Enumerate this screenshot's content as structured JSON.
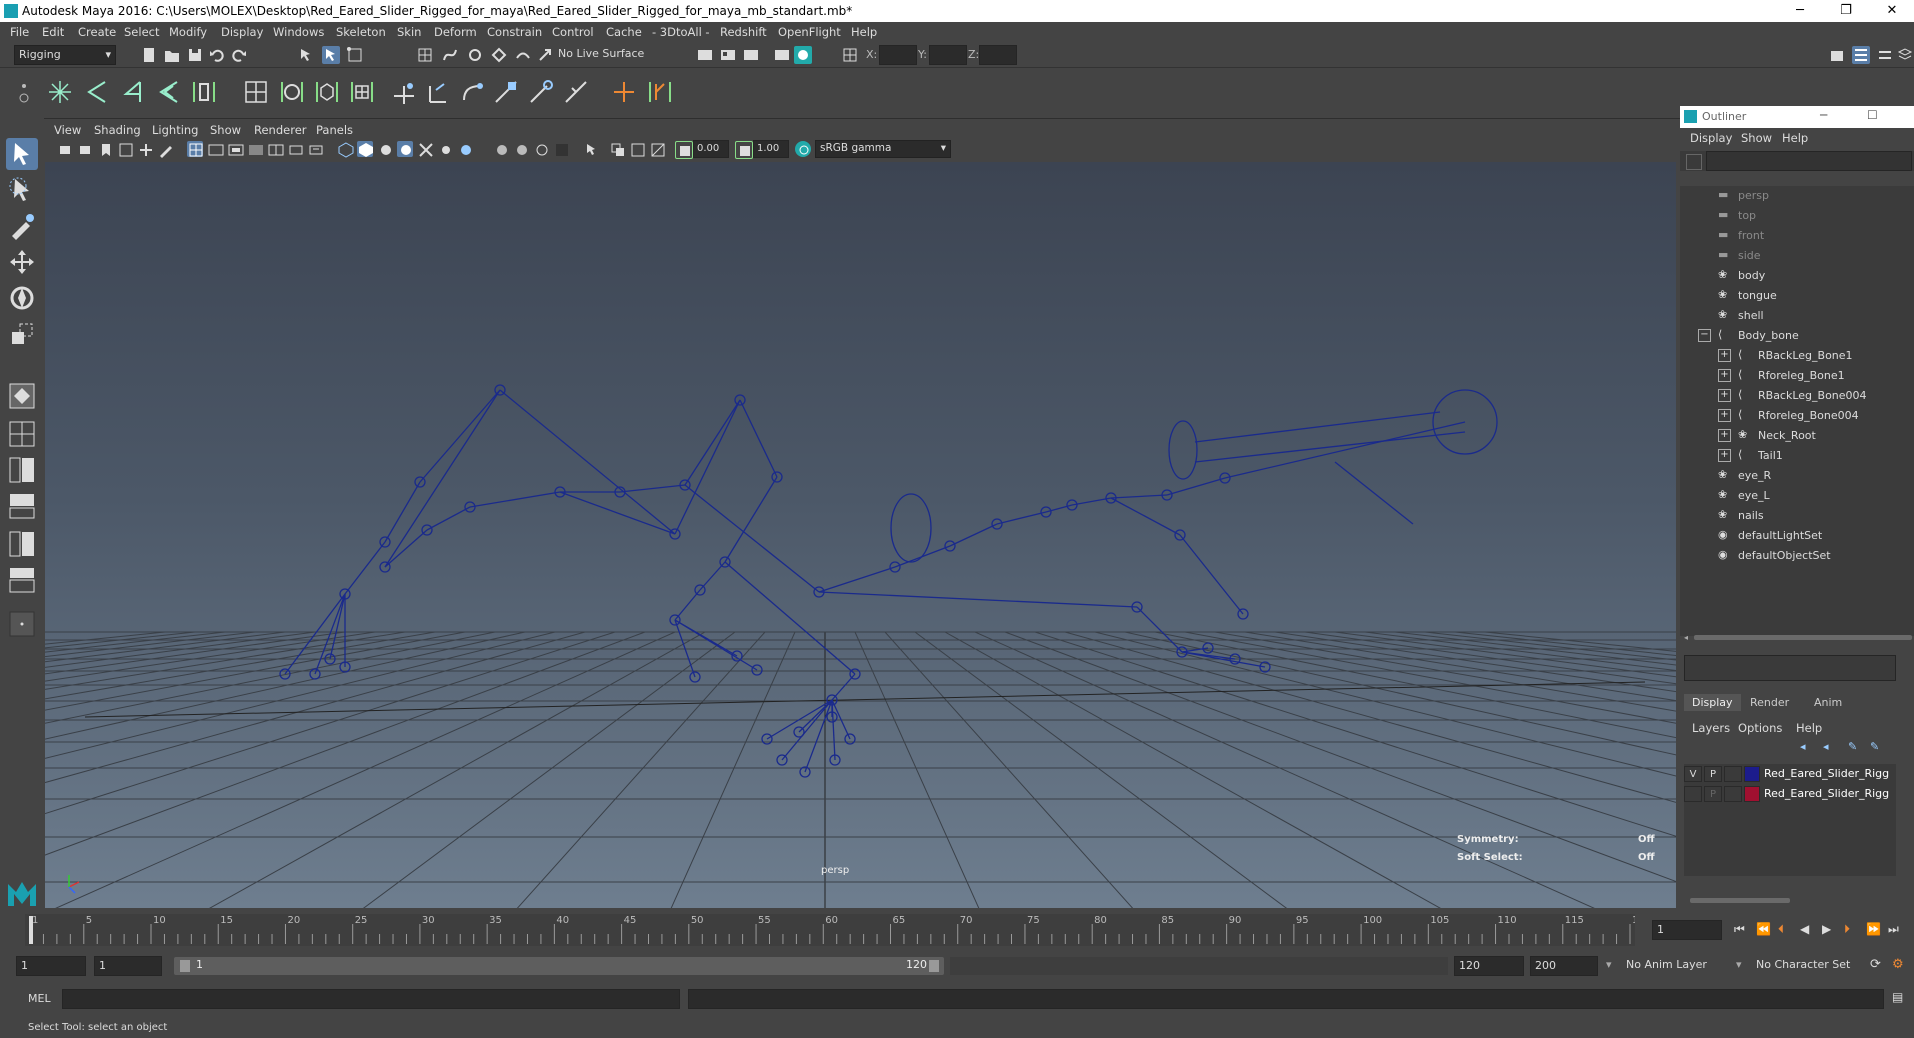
{
  "window": {
    "title": "Autodesk Maya 2016: C:\\Users\\MOLEX\\Desktop\\Red_Eared_Slider_Rigged_for_maya\\Red_Eared_Slider_Rigged_for_maya_mb_standart.mb*",
    "minimize": "─",
    "restore": "❐",
    "close": "✕"
  },
  "menubar": [
    "File",
    "Edit",
    "Create",
    "Select",
    "Modify",
    "Display",
    "Windows",
    "Skeleton",
    "Skin",
    "Deform",
    "Constrain",
    "Control",
    "Cache",
    "- 3DtoAll -",
    "Redshift",
    "OpenFlight",
    "Help"
  ],
  "statusline": {
    "menuset": "Rigging",
    "live_surface": "No Live Surface",
    "x_label": "X:",
    "y_label": "Y:",
    "z_label": "Z:"
  },
  "viewport": {
    "menus": [
      "View",
      "Shading",
      "Lighting",
      "Show",
      "Renderer",
      "Panels"
    ],
    "exposure": "0.00",
    "gamma": "1.00",
    "colorspace": "sRGB gamma",
    "camera_label": "persp",
    "hud": {
      "symmetry_label": "Symmetry:",
      "symmetry_value": "Off",
      "soft_select_label": "Soft Select:",
      "soft_select_value": "Off"
    }
  },
  "outliner": {
    "title": "Outliner",
    "menus": [
      "Display",
      "Show",
      "Help"
    ],
    "items": [
      {
        "label": "persp",
        "icon": "camera-icon",
        "dim": true,
        "indent": 0
      },
      {
        "label": "top",
        "icon": "camera-icon",
        "dim": true,
        "indent": 0
      },
      {
        "label": "front",
        "icon": "camera-icon",
        "dim": true,
        "indent": 0
      },
      {
        "label": "side",
        "icon": "camera-icon",
        "dim": true,
        "indent": 0
      },
      {
        "label": "body",
        "icon": "mesh-icon",
        "dim": false,
        "indent": 0
      },
      {
        "label": "tongue",
        "icon": "mesh-icon",
        "dim": false,
        "indent": 0
      },
      {
        "label": "shell",
        "icon": "mesh-icon",
        "dim": false,
        "indent": 0
      },
      {
        "label": "Body_bone",
        "icon": "joint-icon",
        "dim": false,
        "indent": 0,
        "expander": "−"
      },
      {
        "label": "RBackLeg_Bone1",
        "icon": "joint-icon",
        "dim": false,
        "indent": 1,
        "expander": "+"
      },
      {
        "label": "Rforeleg_Bone1",
        "icon": "joint-icon",
        "dim": false,
        "indent": 1,
        "expander": "+"
      },
      {
        "label": "RBackLeg_Bone004",
        "icon": "joint-icon",
        "dim": false,
        "indent": 1,
        "expander": "+"
      },
      {
        "label": "Rforeleg_Bone004",
        "icon": "joint-icon",
        "dim": false,
        "indent": 1,
        "expander": "+"
      },
      {
        "label": "Neck_Root",
        "icon": "mesh-icon",
        "dim": false,
        "indent": 1,
        "expander": "+"
      },
      {
        "label": "Tail1",
        "icon": "joint-icon",
        "dim": false,
        "indent": 1,
        "expander": "+"
      },
      {
        "label": "eye_R",
        "icon": "mesh-icon",
        "dim": false,
        "indent": 0
      },
      {
        "label": "eye_L",
        "icon": "mesh-icon",
        "dim": false,
        "indent": 0
      },
      {
        "label": "nails",
        "icon": "mesh-icon",
        "dim": false,
        "indent": 0
      },
      {
        "label": "defaultLightSet",
        "icon": "set-icon",
        "dim": false,
        "indent": 0
      },
      {
        "label": "defaultObjectSet",
        "icon": "set-icon",
        "dim": false,
        "indent": 0
      }
    ]
  },
  "channelbox": {
    "tabs": [
      "Display",
      "Render",
      "Anim"
    ],
    "menus": [
      "Layers",
      "Options",
      "Help"
    ],
    "layers": [
      {
        "v": "V",
        "p": "P",
        "color": "#1c1c8c",
        "name": "Red_Eared_Slider_Rigg"
      },
      {
        "v": "",
        "p": "P",
        "color": "#a01030",
        "name": "Red_Eared_Slider_Rigg"
      }
    ]
  },
  "timeslider": {
    "ticks": [
      "1",
      "5",
      "10",
      "15",
      "20",
      "25",
      "30",
      "35",
      "40",
      "45",
      "50",
      "55",
      "60",
      "65",
      "70",
      "75",
      "80",
      "85",
      "90",
      "95",
      "100",
      "105",
      "110",
      "115",
      "120"
    ],
    "current_frame": "1"
  },
  "range": {
    "start": "1",
    "playback_start": "1",
    "slider_start": "1",
    "slider_end": "120",
    "playback_end": "120",
    "end": "200",
    "anim_layer": "No Anim Layer",
    "character_set": "No Character Set"
  },
  "command": {
    "label": "MEL"
  },
  "help": {
    "text": "Select Tool: select an object"
  }
}
